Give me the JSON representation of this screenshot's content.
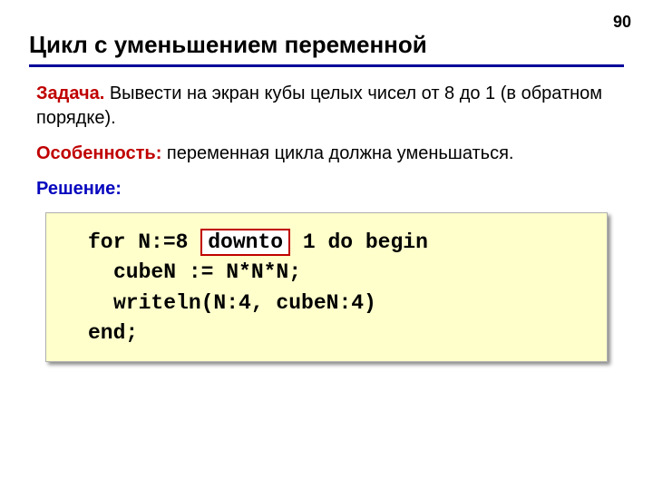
{
  "page_number": "90",
  "title": "Цикл с уменьшением переменной",
  "task": {
    "label": "Задача.",
    "text": " Вывести на экран кубы целых чисел от 8 до 1 (в обратном порядке)."
  },
  "feature": {
    "label": "Особенность:",
    "text": " переменная цикла должна уменьшаться."
  },
  "solution_label": "Решение:",
  "code": {
    "line1_pre": "for N:=8 ",
    "line1_keyword": "downto",
    "line1_post": " 1 do begin",
    "line2": "cubeN := N*N*N;",
    "line3": "writeln(N:4, cubeN:4)",
    "line4": "end;"
  }
}
